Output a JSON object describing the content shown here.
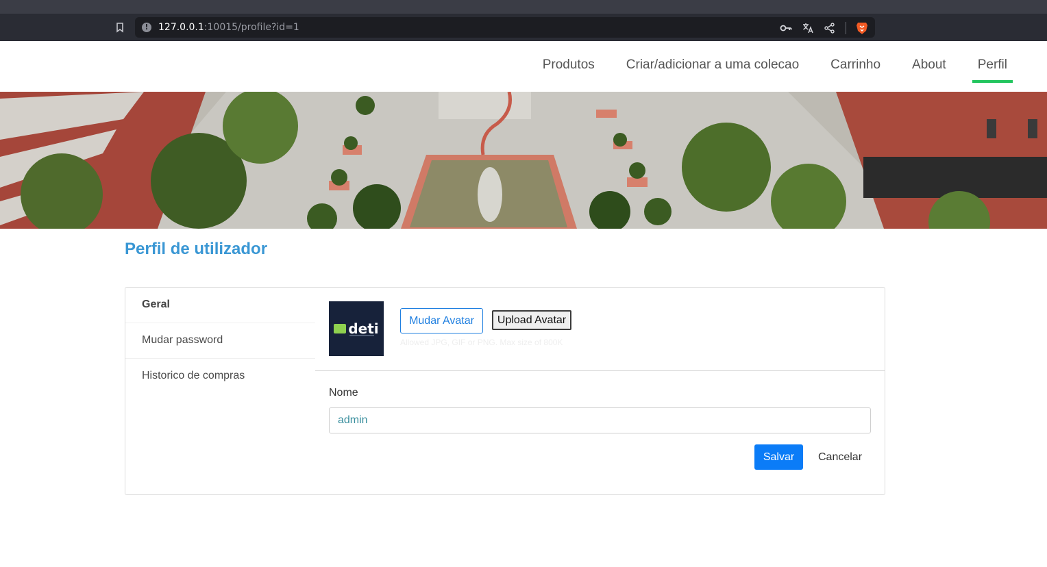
{
  "browser": {
    "url_host": "127.0.0.1",
    "url_rest": ":10015/profile?id=1",
    "icons": [
      "bookmark-icon",
      "info-icon",
      "key-icon",
      "translate-icon",
      "share-icon",
      "brave-lion-icon"
    ]
  },
  "nav": {
    "items": [
      {
        "label": "Produtos"
      },
      {
        "label": "Criar/adicionar a uma colecao"
      },
      {
        "label": "Carrinho"
      },
      {
        "label": "About"
      },
      {
        "label": "Perfil",
        "active": true
      }
    ],
    "active_color": "#22c55e"
  },
  "page": {
    "title": "Perfil de utilizador",
    "title_color": "#3a97d4"
  },
  "sidebar": {
    "items": [
      {
        "label": "Geral",
        "active": true
      },
      {
        "label": "Mudar password"
      },
      {
        "label": "Historico de compras"
      }
    ]
  },
  "avatar": {
    "logo_text": "deti",
    "change_label": "Mudar Avatar",
    "upload_label": "Upload Avatar",
    "hint": "Allowed JPG, GIF or PNG. Max size of 800K"
  },
  "form": {
    "name_label": "Nome",
    "name_value": "admin",
    "save_label": "Salvar",
    "cancel_label": "Cancelar",
    "primary_color": "#0b7cf7"
  }
}
